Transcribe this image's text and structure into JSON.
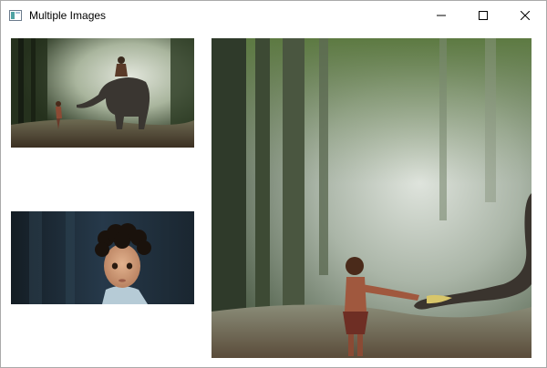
{
  "window": {
    "title": "Multiple Images",
    "controls": {
      "minimize_icon": "minimize-icon",
      "maximize_icon": "maximize-icon",
      "close_icon": "close-icon"
    }
  },
  "images": [
    {
      "name": "image-elephant-scene-small",
      "subject": "forest-elephant-boy-photo"
    },
    {
      "name": "image-child-portrait",
      "subject": "curly-haired-child-photo"
    },
    {
      "name": "image-elephant-scene-large",
      "subject": "boy-feeding-elephant-photo"
    }
  ],
  "colors": {
    "window_bg": "#ffffff",
    "border": "#aaaaaa",
    "forest_dark": "#1f2a1c",
    "forest_mist": "#c9d2c8",
    "child_bg": "#1e2d38"
  }
}
